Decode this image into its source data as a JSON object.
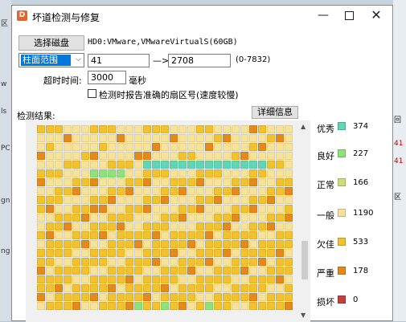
{
  "window": {
    "title": "坏道检测与修复",
    "min_glyph": "—",
    "close_glyph": "✕"
  },
  "disk": {
    "select_button": "选择磁盘",
    "name": "HD0:VMware,VMwareVirtualS(60GB)"
  },
  "range": {
    "mode": "柱面范围",
    "start": "41",
    "arrow": "—>",
    "end": "2708",
    "limit": "(0-7832)"
  },
  "timeout": {
    "label": "超时时间:",
    "value": "3000",
    "unit": "毫秒"
  },
  "option": {
    "label": "检测时报告准确的扇区号(速度较慢)",
    "checked": false
  },
  "results": {
    "label": "检测结果:",
    "detail_button": "详细信息"
  },
  "legend": [
    {
      "name": "优秀",
      "count": "374",
      "color": "#5fd6b6"
    },
    {
      "name": "良好",
      "count": "227",
      "color": "#8fe27a"
    },
    {
      "name": "正常",
      "count": "166",
      "color": "#c9e07a"
    },
    {
      "name": "一般",
      "count": "1190",
      "color": "#f7e29a"
    },
    {
      "name": "欠佳",
      "count": "533",
      "color": "#f2c12e"
    },
    {
      "name": "严重",
      "count": "178",
      "color": "#e28a1c"
    },
    {
      "name": "损坏",
      "count": "0",
      "color": "#c43f3f"
    }
  ],
  "background": {
    "left_fragments": [
      "区",
      "w",
      "ls",
      "PC",
      "gn",
      "ng"
    ],
    "right_fragments": [
      "回",
      "41",
      "41",
      "区"
    ]
  }
}
